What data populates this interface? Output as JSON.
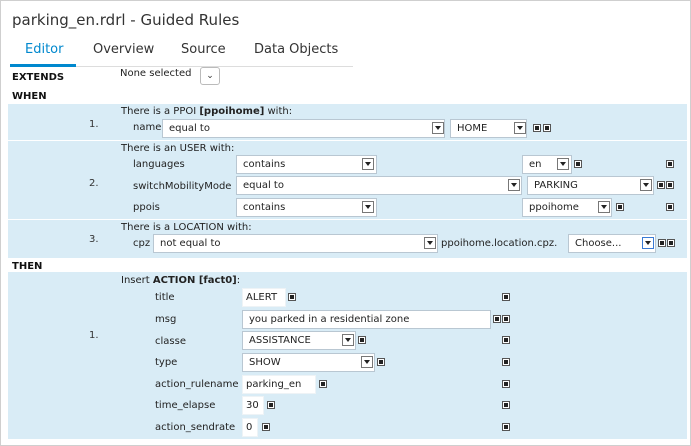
{
  "title": "parking_en.rdrl - Guided Rules",
  "tabs": [
    {
      "label": "Editor"
    },
    {
      "label": "Overview"
    },
    {
      "label": "Source"
    },
    {
      "label": "Data Objects"
    }
  ],
  "extends": {
    "label": "EXTENDS",
    "value": "None selected"
  },
  "when_label": "WHEN",
  "then_label": "THEN",
  "conditions": [
    {
      "number": "1.",
      "header_prefix": "There is a PPOI ",
      "header_bold": "[ppoihome]",
      "header_suffix": " with:",
      "field": "name",
      "operator": "equal to",
      "value": "HOME"
    },
    {
      "number": "2.",
      "header": "There is an USER with:",
      "rows": [
        {
          "field": "languages",
          "operator": "contains",
          "value": "en"
        },
        {
          "field": "switchMobilityMode",
          "operator": "equal to",
          "value": "PARKING"
        },
        {
          "field": "ppois",
          "operator": "contains",
          "value": "ppoihome"
        }
      ]
    },
    {
      "number": "3.",
      "header": "There is a LOCATION with:",
      "field": "cpz",
      "operator": "not equal to",
      "expression": "ppoihome.location.cpz.",
      "choose": "Choose..."
    }
  ],
  "action": {
    "number": "1.",
    "header_prefix": "Insert ",
    "header_bold": "ACTION [fact0]",
    "header_suffix": ":",
    "rows": [
      {
        "field": "title",
        "value": "ALERT"
      },
      {
        "field": "msg",
        "value": "you parked in a residential zone"
      },
      {
        "field": "classe",
        "value": "ASSISTANCE"
      },
      {
        "field": "type",
        "value": "SHOW"
      },
      {
        "field": "action_rulename",
        "value": "parking_en"
      },
      {
        "field": "time_elapse",
        "value": "30"
      },
      {
        "field": "action_sendrate",
        "value": "0"
      }
    ]
  }
}
